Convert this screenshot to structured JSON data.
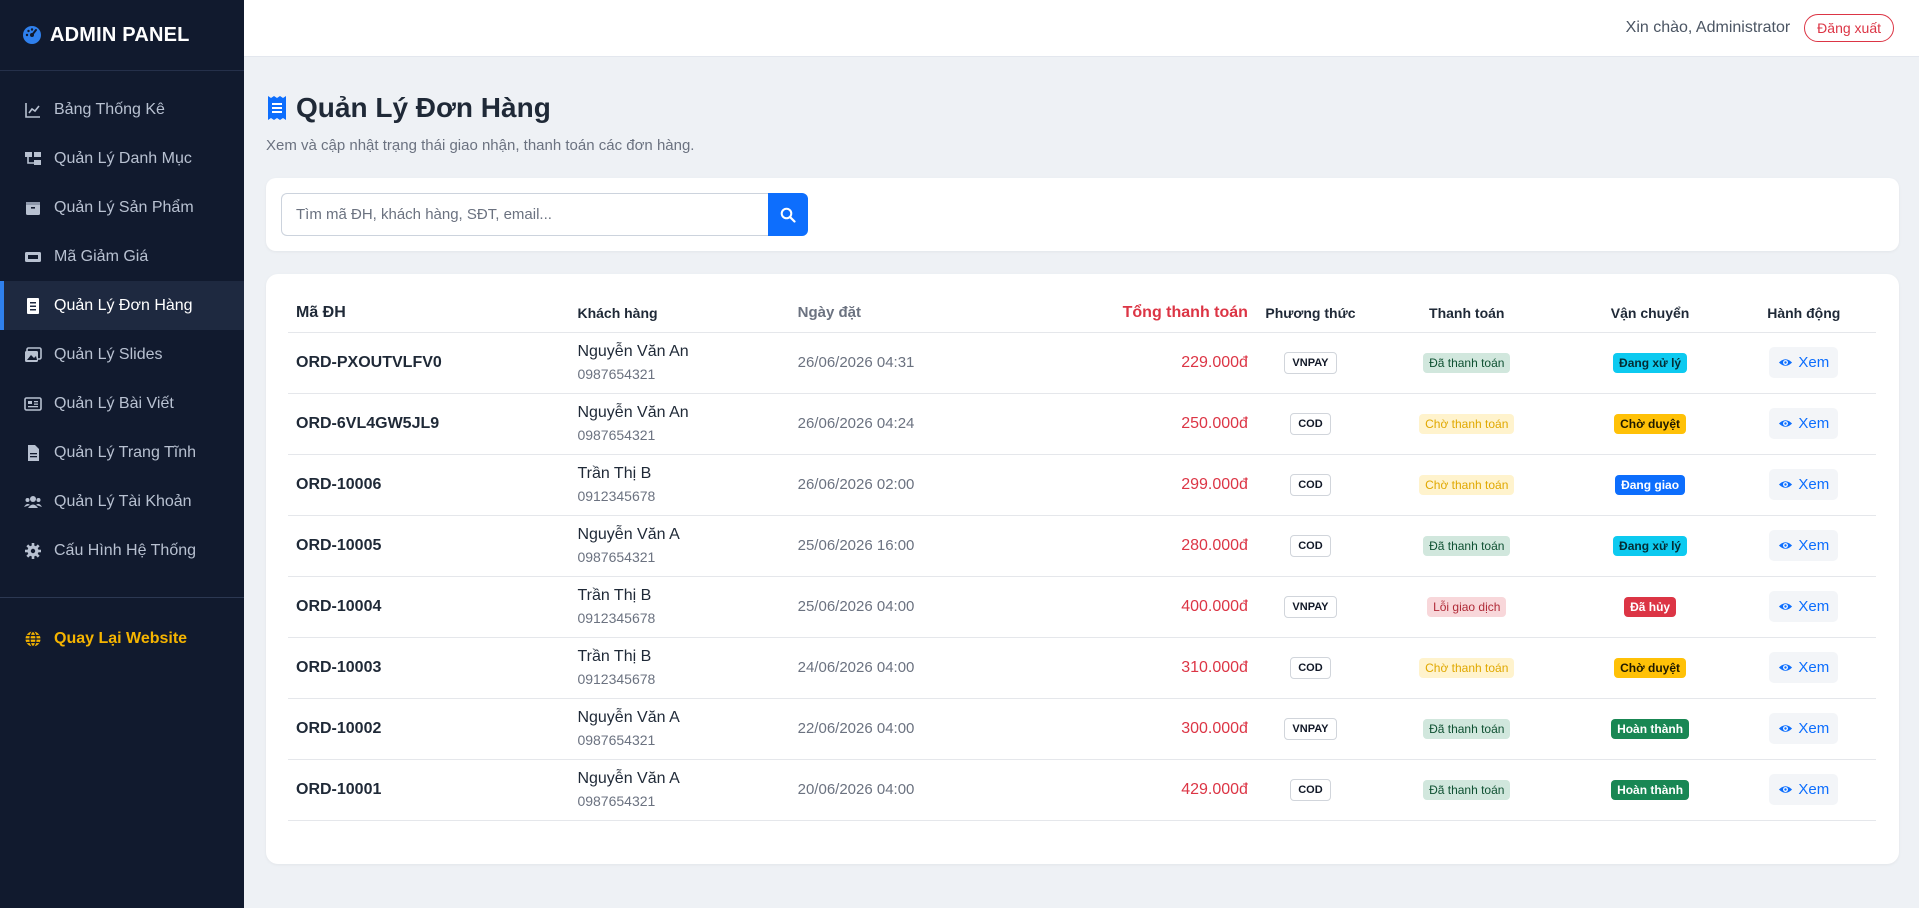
{
  "brand": {
    "title": "ADMIN PANEL"
  },
  "sidebar": {
    "items": [
      {
        "label": "Bảng Thống Kê",
        "icon": "chart-line-icon"
      },
      {
        "label": "Quản Lý Danh Mục",
        "icon": "category-tree-icon"
      },
      {
        "label": "Quản Lý Sản Phẩm",
        "icon": "box-icon"
      },
      {
        "label": "Mã Giảm Giá",
        "icon": "ticket-icon"
      },
      {
        "label": "Quản Lý Đơn Hàng",
        "icon": "receipt-icon",
        "active": true
      },
      {
        "label": "Quản Lý Slides",
        "icon": "images-icon"
      },
      {
        "label": "Quản Lý Bài Viết",
        "icon": "newspaper-icon"
      },
      {
        "label": "Quản Lý Trang Tĩnh",
        "icon": "file-icon"
      },
      {
        "label": "Quản Lý Tài Khoản",
        "icon": "users-icon"
      },
      {
        "label": "Cấu Hình Hệ Thống",
        "icon": "gear-icon"
      }
    ],
    "back_label": "Quay Lại Website"
  },
  "topbar": {
    "greeting": "Xin chào, Administrator",
    "logout_label": "Đăng xuất"
  },
  "page": {
    "title": "Quản Lý Đơn Hàng",
    "subtitle": "Xem và cập nhật trạng thái giao nhận, thanh toán các đơn hàng."
  },
  "search": {
    "placeholder": "Tìm mã ĐH, khách hàng, SĐT, email..."
  },
  "table": {
    "headers": {
      "code": "Mã ĐH",
      "customer": "Khách hàng",
      "date": "Ngày đặt",
      "total": "Tổng thanh toán",
      "method": "Phương thức",
      "payment": "Thanh toán",
      "shipping": "Vận chuyển",
      "action": "Hành động"
    },
    "action_label": "Xem",
    "rows": [
      {
        "code": "ORD-PXOUTVLFV0",
        "name": "Nguyễn Văn An",
        "phone": "0987654321",
        "date": "26/06/2026 04:31",
        "total": "229.000đ",
        "method": "VNPAY",
        "payment": "Đã thanh toán",
        "shipping": "Đang xử lý"
      },
      {
        "code": "ORD-6VL4GW5JL9",
        "name": "Nguyễn Văn An",
        "phone": "0987654321",
        "date": "26/06/2026 04:24",
        "total": "250.000đ",
        "method": "COD",
        "payment": "Chờ thanh toán",
        "shipping": "Chờ duyệt"
      },
      {
        "code": "ORD-10006",
        "name": "Trần Thị B",
        "phone": "0912345678",
        "date": "26/06/2026 02:00",
        "total": "299.000đ",
        "method": "COD",
        "payment": "Chờ thanh toán",
        "shipping": "Đang giao"
      },
      {
        "code": "ORD-10005",
        "name": "Nguyễn Văn A",
        "phone": "0987654321",
        "date": "25/06/2026 16:00",
        "total": "280.000đ",
        "method": "COD",
        "payment": "Đã thanh toán",
        "shipping": "Đang xử lý"
      },
      {
        "code": "ORD-10004",
        "name": "Trần Thị B",
        "phone": "0912345678",
        "date": "25/06/2026 04:00",
        "total": "400.000đ",
        "method": "VNPAY",
        "payment": "Lỗi giao dịch",
        "shipping": "Đã hủy"
      },
      {
        "code": "ORD-10003",
        "name": "Trần Thị B",
        "phone": "0912345678",
        "date": "24/06/2026 04:00",
        "total": "310.000đ",
        "method": "COD",
        "payment": "Chờ thanh toán",
        "shipping": "Chờ duyệt"
      },
      {
        "code": "ORD-10002",
        "name": "Nguyễn Văn A",
        "phone": "0987654321",
        "date": "22/06/2026 04:00",
        "total": "300.000đ",
        "method": "VNPAY",
        "payment": "Đã thanh toán",
        "shipping": "Hoàn thành"
      },
      {
        "code": "ORD-10001",
        "name": "Nguyễn Văn A",
        "phone": "0987654321",
        "date": "20/06/2026 04:00",
        "total": "429.000đ",
        "method": "COD",
        "payment": "Đã thanh toán",
        "shipping": "Hoàn thành"
      }
    ]
  },
  "colors": {
    "sidebar_bg": "#111a2e",
    "primary": "#0d6efd",
    "danger": "#dc3545",
    "back_link": "#f5b400"
  }
}
